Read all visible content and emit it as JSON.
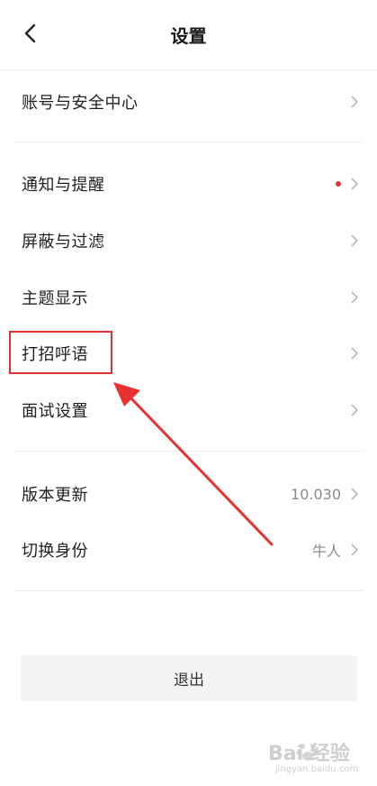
{
  "header": {
    "title": "设置"
  },
  "rows": [
    {
      "label": "账号与安全中心"
    },
    {
      "label": "通知与提醒",
      "has_dot": true
    },
    {
      "label": "屏蔽与过滤"
    },
    {
      "label": "主题显示"
    },
    {
      "label": "打招呼语"
    },
    {
      "label": "面试设置"
    },
    {
      "label": "版本更新",
      "value": "10.030"
    },
    {
      "label": "切换身份",
      "value": "牛人"
    }
  ],
  "logout": {
    "label": "退出"
  },
  "watermark": {
    "main": "Bai 经验",
    "sub": "jingyan.baidu.com"
  },
  "colors": {
    "accent_red": "#e03030",
    "dot_red": "#e23232",
    "text": "#1f1f1f",
    "muted": "#8a8a8a"
  }
}
